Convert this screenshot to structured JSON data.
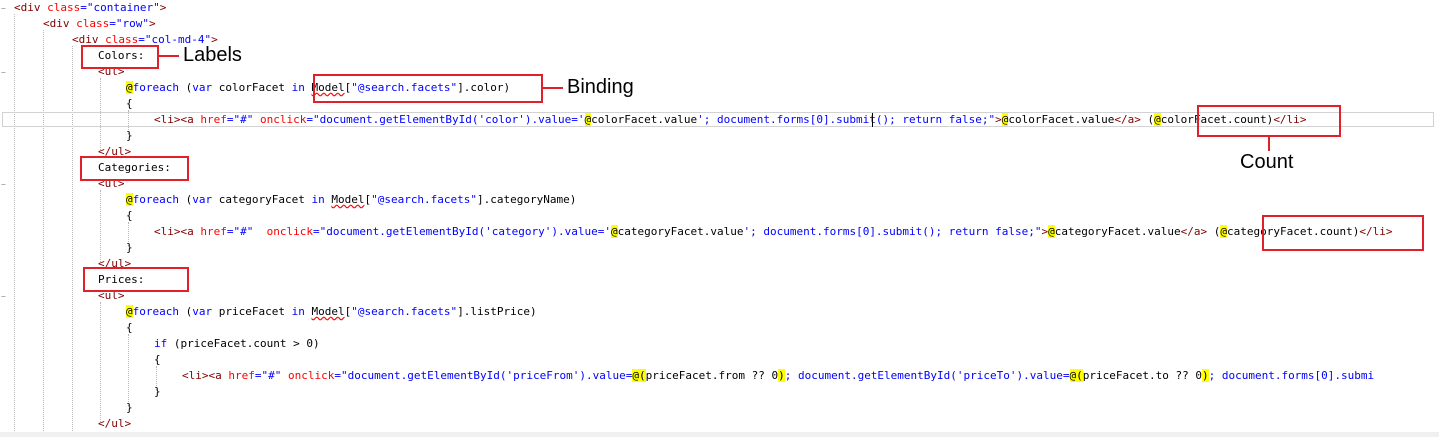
{
  "code_lines": [
    [
      [
        "tag",
        "<"
      ],
      [
        "tag",
        "div"
      ],
      [
        "plain",
        " "
      ],
      [
        "attr",
        "class"
      ],
      [
        "punct",
        "="
      ],
      [
        "str",
        "\"container\""
      ],
      [
        "tag",
        ">"
      ]
    ],
    [
      [
        "tag",
        "<"
      ],
      [
        "tag",
        "div"
      ],
      [
        "plain",
        " "
      ],
      [
        "attr",
        "class"
      ],
      [
        "punct",
        "="
      ],
      [
        "str",
        "\"row\""
      ],
      [
        "tag",
        ">"
      ]
    ],
    [
      [
        "tag",
        "<"
      ],
      [
        "tag",
        "div"
      ],
      [
        "plain",
        " "
      ],
      [
        "attr",
        "class"
      ],
      [
        "punct",
        "="
      ],
      [
        "str",
        "\"col-md-4\""
      ],
      [
        "tag",
        ">"
      ]
    ],
    [
      [
        "plain",
        "Colors:"
      ]
    ],
    [
      [
        "tag",
        "<"
      ],
      [
        "tag",
        "ul"
      ],
      [
        "tag",
        ">"
      ]
    ],
    [
      [
        "at",
        "@"
      ],
      [
        "kw",
        "foreach"
      ],
      [
        "plain",
        " ("
      ],
      [
        "kw",
        "var"
      ],
      [
        "plain",
        " colorFacet "
      ],
      [
        "kw",
        "in"
      ],
      [
        "plain",
        " "
      ],
      [
        "sq",
        "Model"
      ],
      [
        "plain",
        "["
      ],
      [
        "str",
        "\"@search.facets\""
      ],
      [
        "plain",
        "].color)"
      ]
    ],
    [
      [
        "plain",
        "{"
      ]
    ],
    [
      [
        "tag",
        "<"
      ],
      [
        "tag",
        "li"
      ],
      [
        "tag",
        "><"
      ],
      [
        "tag",
        "a"
      ],
      [
        "plain",
        " "
      ],
      [
        "attr",
        "href"
      ],
      [
        "punct",
        "="
      ],
      [
        "str",
        "\"#\""
      ],
      [
        "plain",
        " "
      ],
      [
        "attr",
        "onclick"
      ],
      [
        "punct",
        "="
      ],
      [
        "str",
        "\"document.getElementById('color').value='"
      ],
      [
        "at",
        "@"
      ],
      [
        "plain",
        "colorFacet.value"
      ],
      [
        "str",
        "'; document.forms[0].submit(); return false;\""
      ],
      [
        "tag",
        ">"
      ],
      [
        "at",
        "@"
      ],
      [
        "plain",
        "colorFacet.value"
      ],
      [
        "tag",
        "</"
      ],
      [
        "tag",
        "a"
      ],
      [
        "tag",
        ">"
      ],
      [
        "plain",
        " ("
      ],
      [
        "at",
        "@"
      ],
      [
        "plain",
        "colorFacet.count)"
      ],
      [
        "tag",
        "</"
      ],
      [
        "tag",
        "li"
      ],
      [
        "tag",
        ">"
      ]
    ],
    [
      [
        "plain",
        "}"
      ]
    ],
    [
      [
        "tag",
        "</"
      ],
      [
        "tag",
        "ul"
      ],
      [
        "tag",
        ">"
      ]
    ],
    [
      [
        "plain",
        "Categories:"
      ]
    ],
    [
      [
        "tag",
        "<"
      ],
      [
        "tag",
        "ul"
      ],
      [
        "tag",
        ">"
      ]
    ],
    [
      [
        "at",
        "@"
      ],
      [
        "kw",
        "foreach"
      ],
      [
        "plain",
        " ("
      ],
      [
        "kw",
        "var"
      ],
      [
        "plain",
        " categoryFacet "
      ],
      [
        "kw",
        "in"
      ],
      [
        "plain",
        " "
      ],
      [
        "sq",
        "Model"
      ],
      [
        "plain",
        "["
      ],
      [
        "str",
        "\"@search.facets\""
      ],
      [
        "plain",
        "].categoryName)"
      ]
    ],
    [
      [
        "plain",
        "{"
      ]
    ],
    [
      [
        "tag",
        "<"
      ],
      [
        "tag",
        "li"
      ],
      [
        "tag",
        "><"
      ],
      [
        "tag",
        "a"
      ],
      [
        "plain",
        " "
      ],
      [
        "attr",
        "href"
      ],
      [
        "punct",
        "="
      ],
      [
        "str",
        "\"#\""
      ],
      [
        "plain",
        "  "
      ],
      [
        "attr",
        "onclick"
      ],
      [
        "punct",
        "="
      ],
      [
        "str",
        "\"document.getElementById('category').value='"
      ],
      [
        "at",
        "@"
      ],
      [
        "plain",
        "categoryFacet.value"
      ],
      [
        "str",
        "'; document.forms[0].submit(); return false;\""
      ],
      [
        "tag",
        ">"
      ],
      [
        "at",
        "@"
      ],
      [
        "plain",
        "categoryFacet.value"
      ],
      [
        "tag",
        "</"
      ],
      [
        "tag",
        "a"
      ],
      [
        "tag",
        ">"
      ],
      [
        "plain",
        " ("
      ],
      [
        "at",
        "@"
      ],
      [
        "plain",
        "categoryFacet.count)"
      ],
      [
        "tag",
        "</"
      ],
      [
        "tag",
        "li"
      ],
      [
        "tag",
        ">"
      ]
    ],
    [
      [
        "plain",
        "}"
      ]
    ],
    [
      [
        "tag",
        "</"
      ],
      [
        "tag",
        "ul"
      ],
      [
        "tag",
        ">"
      ]
    ],
    [
      [
        "plain",
        "Prices:"
      ]
    ],
    [
      [
        "tag",
        "<"
      ],
      [
        "tag",
        "ul"
      ],
      [
        "tag",
        ">"
      ]
    ],
    [
      [
        "at",
        "@"
      ],
      [
        "kw",
        "foreach"
      ],
      [
        "plain",
        " ("
      ],
      [
        "kw",
        "var"
      ],
      [
        "plain",
        " priceFacet "
      ],
      [
        "kw",
        "in"
      ],
      [
        "plain",
        " "
      ],
      [
        "sq",
        "Model"
      ],
      [
        "plain",
        "["
      ],
      [
        "str",
        "\"@search.facets\""
      ],
      [
        "plain",
        "].listPrice)"
      ]
    ],
    [
      [
        "plain",
        "{"
      ]
    ],
    [
      [
        "kw",
        "if"
      ],
      [
        "plain",
        " (priceFacet.count > 0)"
      ]
    ],
    [
      [
        "plain",
        "{"
      ]
    ],
    [
      [
        "tag",
        "<"
      ],
      [
        "tag",
        "li"
      ],
      [
        "tag",
        "><"
      ],
      [
        "tag",
        "a"
      ],
      [
        "plain",
        " "
      ],
      [
        "attr",
        "href"
      ],
      [
        "punct",
        "="
      ],
      [
        "str",
        "\"#\""
      ],
      [
        "plain",
        " "
      ],
      [
        "attr",
        "onclick"
      ],
      [
        "punct",
        "="
      ],
      [
        "str",
        "\"document.getElementById('priceFrom').value="
      ],
      [
        "at",
        "@("
      ],
      [
        "plain",
        "priceFacet.from ?? 0"
      ],
      [
        "at",
        ")"
      ],
      [
        "str",
        "; document.getElementById('priceTo').value="
      ],
      [
        "at",
        "@("
      ],
      [
        "plain",
        "priceFacet.to ?? 0"
      ],
      [
        "at",
        ")"
      ],
      [
        "str",
        "; document.forms[0].submi"
      ]
    ],
    [
      [
        "plain",
        "}"
      ]
    ],
    [
      [
        "plain",
        "}"
      ]
    ],
    [
      [
        "tag",
        "</"
      ],
      [
        "tag",
        "ul"
      ],
      [
        "tag",
        ">"
      ]
    ]
  ],
  "callouts": {
    "labels": "Labels",
    "binding": "Binding",
    "count": "Count"
  },
  "colors": {
    "annotation_red": "#e0202a",
    "razor_highlight": "#ffff00",
    "keyword_blue": "#0000ff",
    "tag_maroon": "#800000",
    "attribute_red": "#ff0000"
  }
}
